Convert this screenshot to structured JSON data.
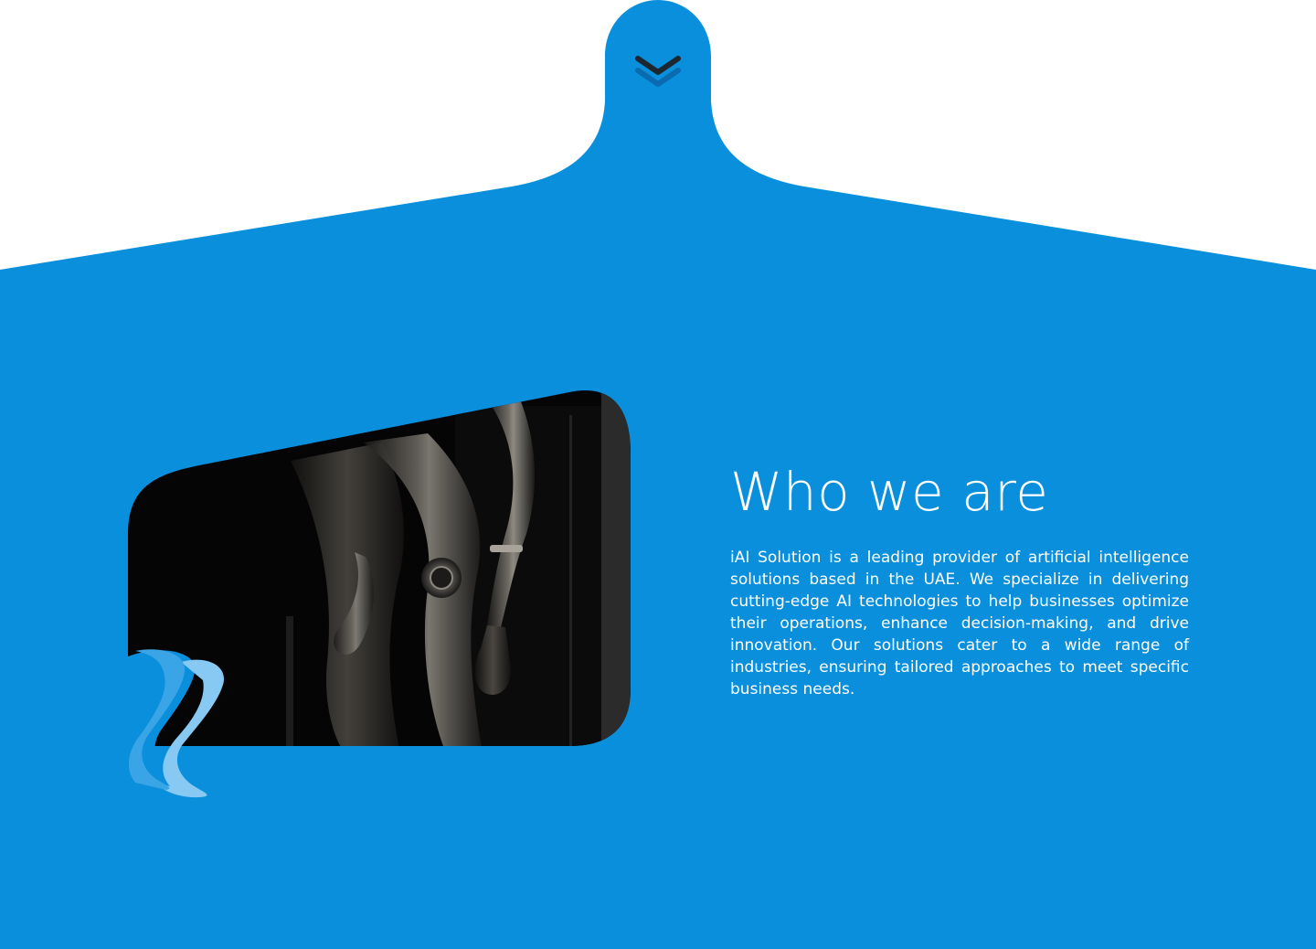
{
  "theme": {
    "accent": "#0a8fdc",
    "background": "#ffffff",
    "text": "#ffffff",
    "wave_light": "#87c9f2",
    "wave_mid": "#3aa5e6",
    "chevron_primary": "#1c2730",
    "chevron_secondary": "#0b6bb0"
  },
  "icons": {
    "scroll_down": "double-chevron-down-icon",
    "decor": "wave-ribbon-icon"
  },
  "about": {
    "title": "Who we are",
    "description": "iAI Solution is a leading provider of artificial intelligence solutions based in the UAE. We specialize in delivering cutting-edge AI technologies to help businesses optimize their operations, enhance decision-making, and drive innovation. Our solutions cater to a wide range of industries, ensuring tailored approaches to meet specific business needs."
  }
}
